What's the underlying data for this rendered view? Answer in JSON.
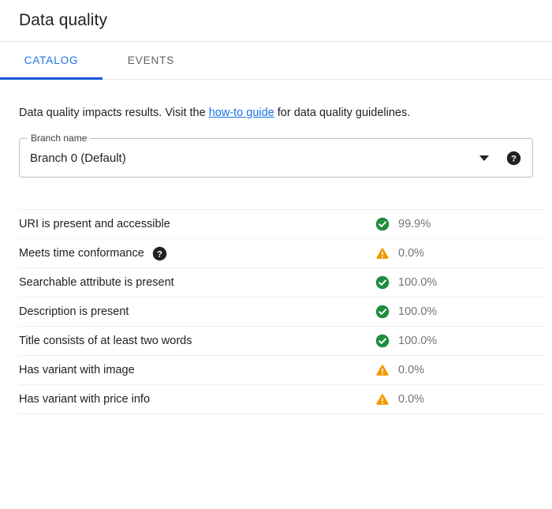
{
  "header": {
    "title": "Data quality"
  },
  "tabs": [
    {
      "label": "CATALOG",
      "active": true
    },
    {
      "label": "EVENTS",
      "active": false
    }
  ],
  "description": {
    "before_link": "Data quality impacts results. Visit the ",
    "link_text": "how-to guide",
    "after_link": " for data quality guidelines."
  },
  "branch_field": {
    "label": "Branch name",
    "value": "Branch 0 (Default)",
    "caret_icon": "chevron-down-icon",
    "help_icon": "help-icon"
  },
  "metrics": {
    "rows": [
      {
        "label": "URI is present and accessible",
        "status": "success",
        "status_icon": "check-circle-icon",
        "value": "99.9%",
        "help": false
      },
      {
        "label": "Meets time conformance",
        "status": "warning",
        "status_icon": "warning-triangle-icon",
        "value": "0.0%",
        "help": true
      },
      {
        "label": "Searchable attribute is present",
        "status": "success",
        "status_icon": "check-circle-icon",
        "value": "100.0%",
        "help": false
      },
      {
        "label": "Description is present",
        "status": "success",
        "status_icon": "check-circle-icon",
        "value": "100.0%",
        "help": false
      },
      {
        "label": "Title consists of at least two words",
        "status": "success",
        "status_icon": "check-circle-icon",
        "value": "100.0%",
        "help": false
      },
      {
        "label": "Has variant with image",
        "status": "warning",
        "status_icon": "warning-triangle-icon",
        "value": "0.0%",
        "help": false
      },
      {
        "label": "Has variant with price info",
        "status": "warning",
        "status_icon": "warning-triangle-icon",
        "value": "0.0%",
        "help": false
      }
    ]
  },
  "colors": {
    "accent_blue": "#1a73e8",
    "tab_indicator": "#1a56db",
    "success_green": "#1e8e3e",
    "warning_orange": "#f29900",
    "value_gray": "#70757a"
  }
}
